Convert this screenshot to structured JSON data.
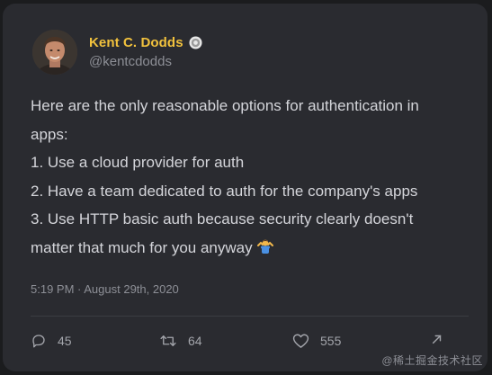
{
  "tweet": {
    "author_name": "Kent C. Dodds",
    "author_handle": "@kentcdodds",
    "lines": [
      "Here are the only reasonable options for authentication in",
      "apps:",
      "1. Use a cloud provider for auth",
      "2. Have a team dedicated to auth for the company's apps",
      "3. Use HTTP basic auth because security clearly doesn't",
      "matter that much for you anyway"
    ],
    "emoji": "person-shrugging-emoji",
    "timestamp": "5:19 PM · August 29th, 2020"
  },
  "actions": {
    "replies": "45",
    "retweets": "64",
    "likes": "555"
  },
  "watermark": "@稀土掘金技术社区",
  "colors": {
    "background": "#1b1c1e",
    "card": "#2a2b30",
    "name": "#f2c23d",
    "text": "#d4d5da",
    "muted": "#8d8f96"
  },
  "icons": {
    "reply": "speech-bubble-icon",
    "retweet": "retweet-arrows-icon",
    "like": "heart-icon",
    "share": "share-arrow-icon",
    "verified": "verified-badge-icon"
  }
}
